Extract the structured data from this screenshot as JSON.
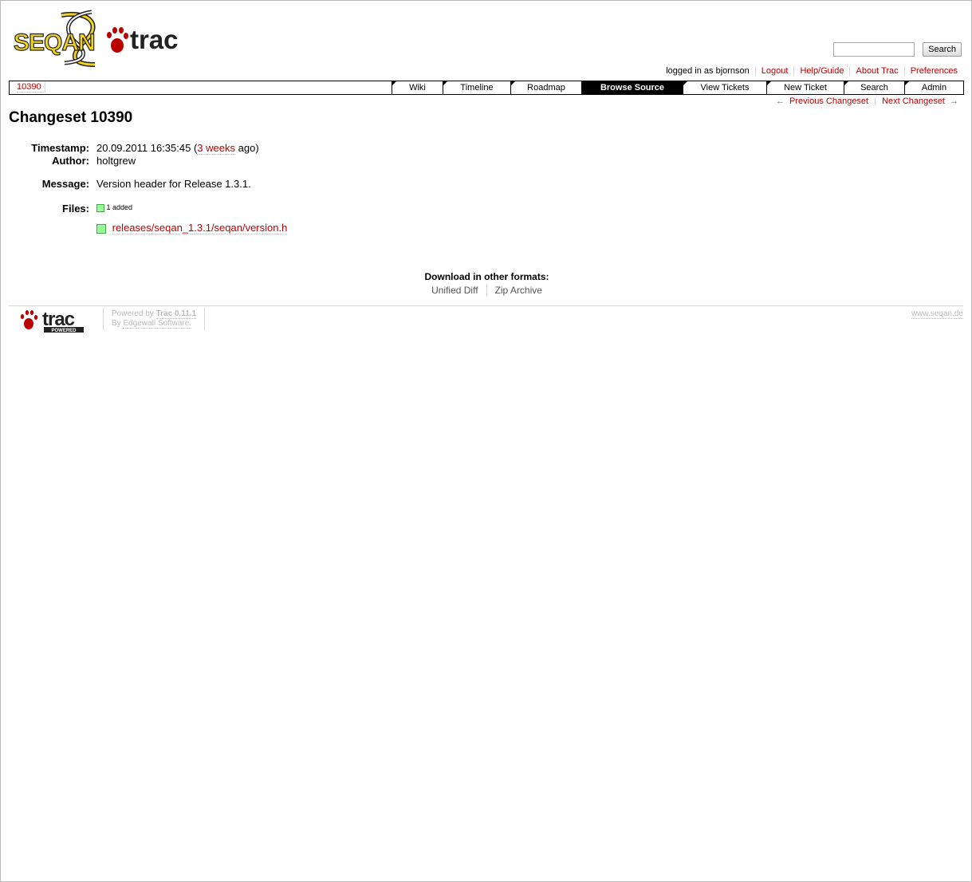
{
  "header": {
    "logo_text_left": "SEQAN",
    "logo_text_right": "trac",
    "search_placeholder": "",
    "search_button": "Search"
  },
  "metanav": {
    "logged_in": "logged in as bjornson",
    "items": [
      "Logout",
      "Help/Guide",
      "About Trac",
      "Preferences"
    ]
  },
  "mainnav": {
    "context": "10390",
    "tabs": [
      {
        "label": "Wiki",
        "active": false
      },
      {
        "label": "Timeline",
        "active": false
      },
      {
        "label": "Roadmap",
        "active": false
      },
      {
        "label": "Browse Source",
        "active": true
      },
      {
        "label": "View Tickets",
        "active": false
      },
      {
        "label": "New Ticket",
        "active": false
      },
      {
        "label": "Search",
        "active": false
      },
      {
        "label": "Admin",
        "active": false
      }
    ]
  },
  "ctxnav": {
    "prev_arrow": "←",
    "prev": "Previous Changeset",
    "next": "Next Changeset",
    "next_arrow": "→"
  },
  "changeset": {
    "title": "Changeset 10390",
    "timestamp_label": "Timestamp:",
    "timestamp_value": "20.09.2011 16:35:45",
    "timestamp_age_open": "(",
    "timestamp_age_link": "3 weeks",
    "timestamp_age_close": "ago)",
    "author_label": "Author:",
    "author_value": "holtgrew",
    "message_label": "Message:",
    "message_value": "Version header for Release 1.3.1.",
    "files_label": "Files:",
    "files_legend": "1 added",
    "files": [
      "releases/seqan_1.3.1/seqan/version.h"
    ]
  },
  "altlinks": {
    "heading": "Download in other formats:",
    "links": [
      "Unified Diff",
      "Zip Archive"
    ]
  },
  "footer": {
    "powered_logo": "trac",
    "powered_badge": "POWERED",
    "powered_by": "Powered by",
    "trac_version": "Trac 0.11.1",
    "by": "By",
    "vendor": "Edgewall Software.",
    "site": "www.seqan.de"
  },
  "colors": {
    "link": "#bb0000",
    "logo_yellow": "#f2d21a",
    "added": "#99ff99"
  }
}
